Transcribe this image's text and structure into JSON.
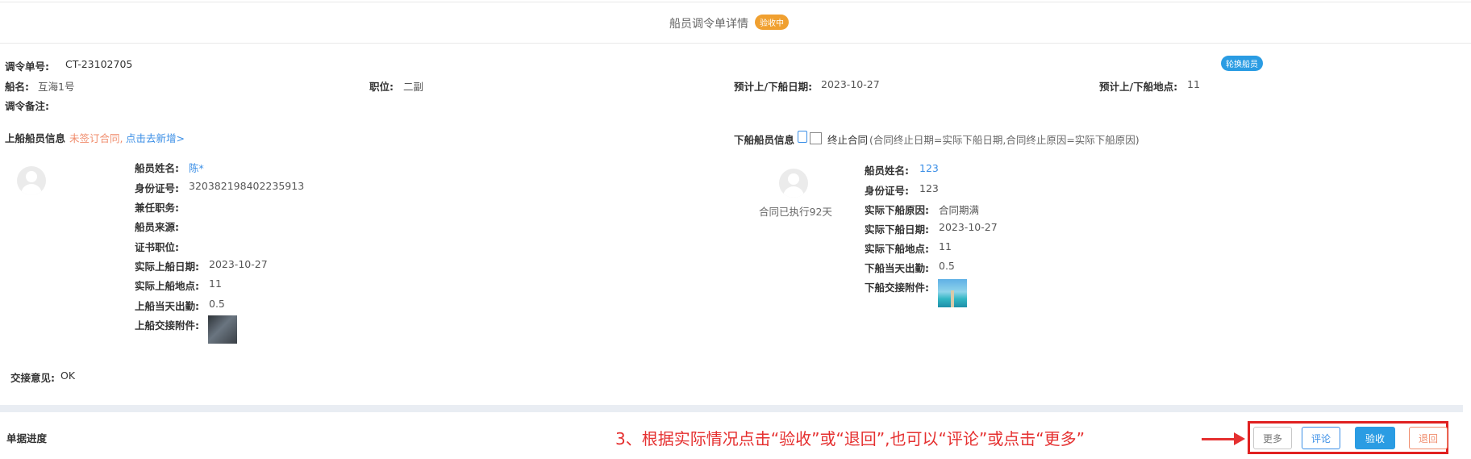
{
  "header": {
    "title": "船员调令单详情",
    "status_badge": "验收中",
    "swap_badge": "轮换船员"
  },
  "order": {
    "order_no_label": "调令单号:",
    "order_no": "CT-23102705",
    "ship_label": "船名:",
    "ship": "互海1号",
    "position_label": "职位:",
    "position": "二副",
    "date_label": "预计上/下船日期:",
    "date": "2023-10-27",
    "place_label": "预计上/下船地点:",
    "place": "11",
    "remark_label": "调令备注:"
  },
  "onboard": {
    "section_title": "上船船员信息",
    "warning": "未签订合同,",
    "add_link": "点击去新增>",
    "fields": [
      {
        "label": "船员姓名:",
        "value": "陈*"
      },
      {
        "label": "身份证号:",
        "value": "320382198402235913"
      },
      {
        "label": "兼任职务:",
        "value": ""
      },
      {
        "label": "船员来源:",
        "value": ""
      },
      {
        "label": "证书职位:",
        "value": ""
      },
      {
        "label": "实际上船日期:",
        "value": "2023-10-27"
      },
      {
        "label": "实际上船地点:",
        "value": "11"
      },
      {
        "label": "上船当天出勤:",
        "value": "0.5"
      },
      {
        "label": "上船交接附件:",
        "value": ""
      }
    ]
  },
  "offboard": {
    "section_title": "下船船员信息",
    "terminate_label": "终止合同",
    "terminate_note": "(合同终止日期=实际下船日期,合同终止原因=实际下船原因)",
    "contract_days": "合同已执行92天",
    "fields": [
      {
        "label": "船员姓名:",
        "value": "123"
      },
      {
        "label": "身份证号:",
        "value": "123"
      },
      {
        "label": "实际下船原因:",
        "value": "合同期满"
      },
      {
        "label": "实际下船日期:",
        "value": "2023-10-27"
      },
      {
        "label": "实际下船地点:",
        "value": "11"
      },
      {
        "label": "下船当天出勤:",
        "value": "0.5"
      },
      {
        "label": "下船交接附件:",
        "value": ""
      }
    ]
  },
  "handover": {
    "label": "交接意见:",
    "value": "OK"
  },
  "progress": {
    "label": "单据进度"
  },
  "annotation": "3、根据实际情况点击“验收”或“退回”,也可以“评论”或点击“更多”",
  "actions": {
    "more": "更多",
    "comment": "评论",
    "accept": "验收",
    "return": "退回"
  },
  "colors": {
    "status_orange": "#f0a030",
    "primary_blue": "#2a9ce3",
    "link_blue": "#3a8ee6",
    "warn_orange": "#f08c6c",
    "annotation_red": "#e53030"
  }
}
